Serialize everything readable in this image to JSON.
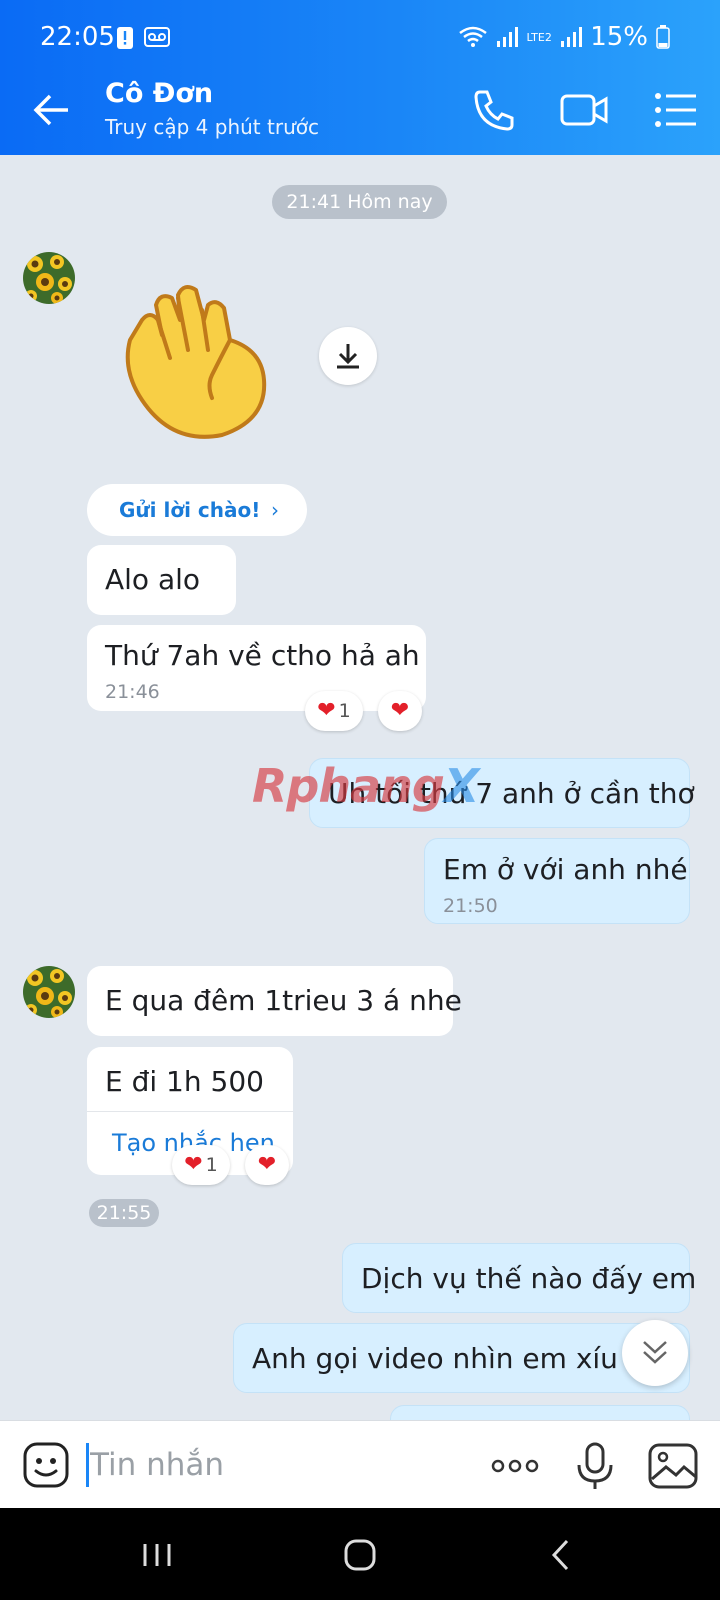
{
  "status_bar": {
    "time": "22:05",
    "battery": "15%",
    "network_label": "LTE2"
  },
  "header": {
    "contact_name": "Cô Đơn",
    "last_seen": "Truy cập 4 phút trước",
    "icons": [
      "back-arrow-icon",
      "phone-icon",
      "video-call-icon",
      "menu-list-icon"
    ]
  },
  "chat": {
    "date_separator": "21:41 Hôm nay",
    "greeting_button": "Gửi lời chào!",
    "watermark": {
      "part1": "Rphang",
      "part2": "X"
    },
    "messages": [
      {
        "side": "in",
        "text": "Alo alo"
      },
      {
        "side": "in",
        "text": "Thứ 7ah về ctho hả ah",
        "time": "21:46",
        "reaction_count": "1"
      },
      {
        "side": "out",
        "text": "Uh tối thứ 7 anh ở cần thơ"
      },
      {
        "side": "out",
        "text": "Em ở với anh nhé",
        "time": "21:50"
      },
      {
        "side": "in",
        "text": "E qua đêm 1trieu 3 á nhe"
      },
      {
        "side": "in",
        "text": "E đi 1h 500",
        "action": "Tạo nhắc hẹn",
        "time": "21:55",
        "reaction_count": "1"
      },
      {
        "side": "out",
        "text": "Dịch vụ thế nào đấy em"
      },
      {
        "side": "out",
        "text": "Anh gọi video nhìn em xíu đc"
      }
    ]
  },
  "composer": {
    "placeholder": "Tin nhắn"
  },
  "colors": {
    "header_start": "#0a6bf5",
    "header_end": "#2ba2fb",
    "chat_bg": "#e2e8ef",
    "outgoing_bubble": "#d7efff",
    "incoming_bubble": "#ffffff",
    "heart": "#e3202a",
    "link": "#1a7bd8"
  }
}
